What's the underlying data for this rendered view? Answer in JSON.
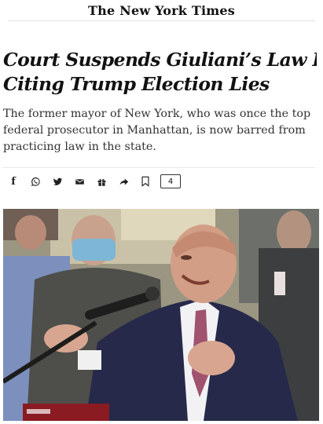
{
  "masthead": {
    "title": "The New York Times"
  },
  "article": {
    "headline_line1": "Court Suspends Giuliani’s Law License,",
    "headline_line2": "Citing Trump Election Lies",
    "summary": "The former mayor of New York, who was once the top federal prosecutor in Manhattan, is now barred from practicing law in the state."
  },
  "share": {
    "buttons": [
      {
        "icon": "facebook-icon",
        "glyph": "f"
      },
      {
        "icon": "whatsapp-icon",
        "glyph": ""
      },
      {
        "icon": "twitter-icon",
        "glyph": ""
      },
      {
        "icon": "email-icon",
        "glyph": ""
      },
      {
        "icon": "gift-icon",
        "glyph": ""
      },
      {
        "icon": "share-icon",
        "glyph": ""
      },
      {
        "icon": "bookmark-icon",
        "glyph": ""
      }
    ],
    "comment_count": "4"
  },
  "photo": {
    "description_icon": "photo-giuliani-podium"
  }
}
